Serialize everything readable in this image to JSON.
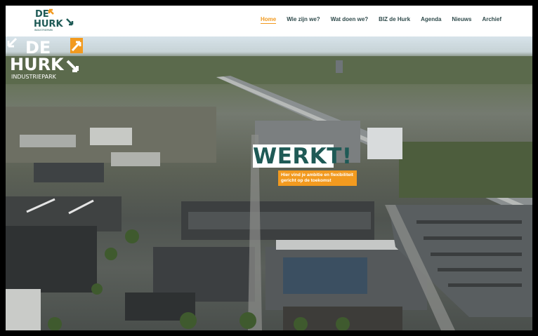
{
  "logo": {
    "line1": "DE",
    "line2": "HURK",
    "line3": "INDUSTRIEPARK"
  },
  "nav": [
    "Home",
    "Wie zijn we?",
    "Wat doen we?",
    "BIZ de Hurk",
    "Agenda",
    "Nieuws",
    "Archief"
  ],
  "nav_active": "Home",
  "hero": {
    "headline": "WERKT!",
    "tagline": "Hier vind je ambitie en flexibiliteit gericht op de toekomst",
    "logo_line1": "DE",
    "logo_line2": "HURK",
    "logo_line3": "INDUSTRIEPARK"
  },
  "colors": {
    "accent": "#f29a1f",
    "brand": "#1f5a56"
  },
  "icons": {
    "scroll": "arrow-down-left-icon"
  }
}
